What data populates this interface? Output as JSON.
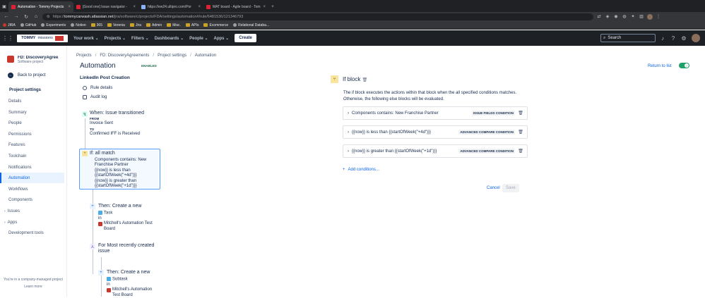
{
  "browser": {
    "tabs": [
      {
        "title": "Automation - Tommy Projects",
        "active": true
      },
      {
        "title": "[Good one] Issue navigator - ",
        "active": false
      },
      {
        "title": "https://ew24.ultipro.com/Por",
        "active": false
      },
      {
        "title": "MAT board - Agile board - Tom",
        "active": false
      }
    ],
    "url_prefix": "https://",
    "url_host": "tommycarwash.atlassian.net",
    "url_path": "/jira/software/c/projects/FDA/settings/automation#/rule/6481536/121346793",
    "bookmarks": [
      "JIRA",
      "GitHub",
      "Experiments",
      "Notion",
      "365",
      "Verenia",
      "Jira",
      "Admin",
      "Misc.",
      "APIs",
      "Ecommerce",
      "Relational Databa..."
    ]
  },
  "topnav": {
    "logo_text": "TOMMY",
    "logo_sub": "missions",
    "items": [
      "Your work",
      "Projects",
      "Filters",
      "Dashboards",
      "People",
      "Apps"
    ],
    "create": "Create",
    "search_placeholder": "Search"
  },
  "sidebar": {
    "project_name": "FD: DiscoveryAgree...",
    "project_type": "Software project",
    "back": "Back to project",
    "heading": "Project settings",
    "items": [
      "Details",
      "Summary",
      "People",
      "Permissions",
      "Features",
      "Toolchain",
      "Notifications",
      "Automation",
      "Workflows",
      "Components",
      "Issues",
      "Apps",
      "Development tools"
    ],
    "footer": "You're in a company-managed project",
    "learn_more": "Learn more"
  },
  "breadcrumbs": [
    "Projects",
    "FD: DiscoveryAgreements",
    "Project settings",
    "Automation"
  ],
  "page_title": "Automation",
  "status": "ENABLED",
  "rule": {
    "name": "LinkedIn Post Creation",
    "links": [
      "Rule details",
      "Audit log"
    ]
  },
  "flow": {
    "trigger": {
      "title": "When: Issue transitioned",
      "from_label": "FROM",
      "from": "Invoice Sent",
      "to_label": "TO",
      "to": "Confirmed IFF is Received"
    },
    "if_block": {
      "title": "If: all match",
      "lines": [
        "Components contains: New Franchise Partner",
        "{{now}} is less than {{startOfWeek(\"+4d\")}}",
        "{{now}} is greater than {{startOfWeek(\"+1d\")}}"
      ]
    },
    "action1": {
      "title": "Then: Create a new",
      "type": "Task",
      "in": "in",
      "board": "Mitchell's Automation Test Board"
    },
    "branch": {
      "title": "For Most recently created issue"
    },
    "action2": {
      "title": "Then: Create a new",
      "type": "Subtask",
      "in": "in",
      "board": "Mitchell's Automation Test Board"
    }
  },
  "panel": {
    "title": "If block",
    "return": "Return to list",
    "description": "The if block executes the actions within that block when the all specified conditions matches. Otherwise, the following else blocks will be evaluated.",
    "conditions": [
      {
        "label": "Components contains: New Franchise Partner",
        "tag": "ISSUE FIELDS CONDITION"
      },
      {
        "label": "{{now}} is less than {{startOfWeek(\"+4d\")}}",
        "tag": "ADVANCED COMPARE CONDITION"
      },
      {
        "label": "{{now}} is greater than {{startOfWeek(\"+1d\")}}",
        "tag": "ADVANCED COMPARE CONDITION"
      }
    ],
    "add_conditions": "Add conditions...",
    "cancel": "Cancel",
    "save": "Save"
  }
}
